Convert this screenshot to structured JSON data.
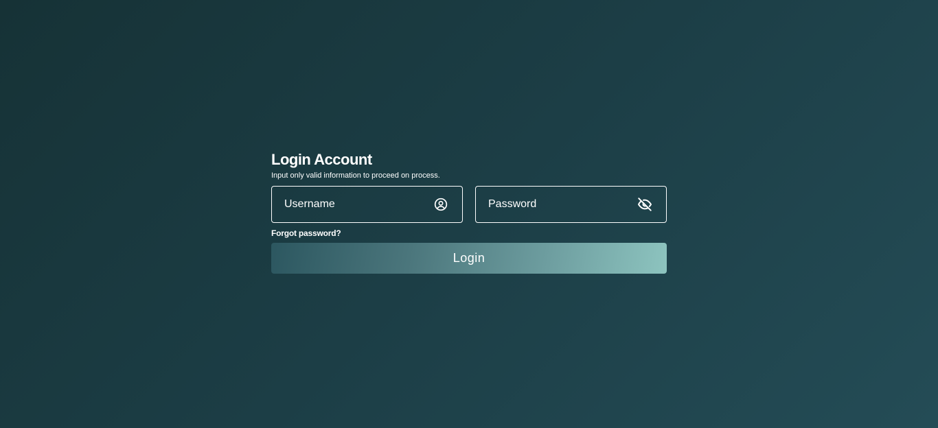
{
  "login": {
    "title": "Login Account",
    "subtitle": "Input only valid information to proceed on process.",
    "username": {
      "placeholder": "Username",
      "value": "",
      "icon": "user-circle-icon"
    },
    "password": {
      "placeholder": "Password",
      "value": "",
      "icon": "eye-slash-icon"
    },
    "forgot_password_label": "Forgot password?",
    "submit_label": "Login"
  },
  "colors": {
    "background_start": "#163236",
    "background_end": "#244c56",
    "button_gradient_start": "#2c5760",
    "button_gradient_end": "#8dc4bf",
    "text": "#ffffff",
    "border": "#ffffff"
  }
}
